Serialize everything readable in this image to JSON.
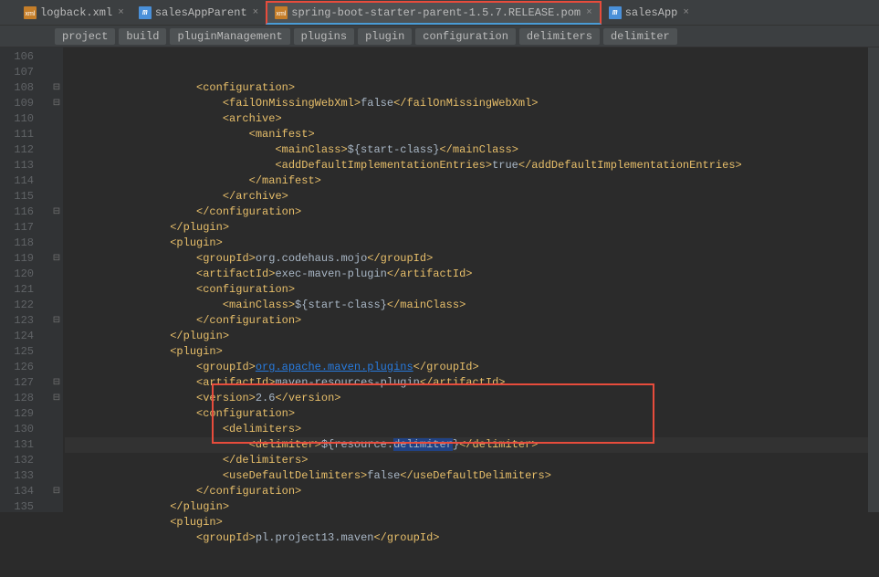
{
  "tabs": [
    {
      "icon": "xml",
      "label": "logback.xml"
    },
    {
      "icon": "m",
      "label": "salesAppParent"
    },
    {
      "icon": "xml",
      "label": "spring-boot-starter-parent-1.5.7.RELEASE.pom",
      "highlighted": true
    },
    {
      "icon": "m",
      "label": "salesApp"
    }
  ],
  "breadcrumbs": [
    "project",
    "build",
    "pluginManagement",
    "plugins",
    "plugin",
    "configuration",
    "delimiters",
    "delimiter"
  ],
  "lines": {
    "start": 106,
    "end": 135
  },
  "code": {
    "l106": {
      "indent": "                    ",
      "parts": [
        {
          "t": "tag",
          "v": "<configuration>"
        }
      ]
    },
    "l107": {
      "indent": "                        ",
      "parts": [
        {
          "t": "tag",
          "v": "<failOnMissingWebXml>"
        },
        {
          "t": "text",
          "v": "false"
        },
        {
          "t": "tag",
          "v": "</failOnMissingWebXml>"
        }
      ]
    },
    "l108": {
      "indent": "                        ",
      "parts": [
        {
          "t": "tag",
          "v": "<archive>"
        }
      ]
    },
    "l109": {
      "indent": "                            ",
      "parts": [
        {
          "t": "tag",
          "v": "<manifest>"
        }
      ]
    },
    "l110": {
      "indent": "                                ",
      "parts": [
        {
          "t": "tag",
          "v": "<mainClass>"
        },
        {
          "t": "text",
          "v": "${start-class}"
        },
        {
          "t": "tag",
          "v": "</mainClass>"
        }
      ]
    },
    "l111": {
      "indent": "                                ",
      "parts": [
        {
          "t": "tag",
          "v": "<addDefaultImplementationEntries>"
        },
        {
          "t": "text",
          "v": "true"
        },
        {
          "t": "tag",
          "v": "</addDefaultImplementationEntries>"
        }
      ]
    },
    "l112": {
      "indent": "                            ",
      "parts": [
        {
          "t": "tag",
          "v": "</manifest>"
        }
      ]
    },
    "l113": {
      "indent": "                        ",
      "parts": [
        {
          "t": "tag",
          "v": "</archive>"
        }
      ]
    },
    "l114": {
      "indent": "                    ",
      "parts": [
        {
          "t": "tag",
          "v": "</configuration>"
        }
      ]
    },
    "l115": {
      "indent": "                ",
      "parts": [
        {
          "t": "tag",
          "v": "</plugin>"
        }
      ]
    },
    "l116": {
      "indent": "                ",
      "parts": [
        {
          "t": "tag",
          "v": "<plugin>"
        }
      ]
    },
    "l117": {
      "indent": "                    ",
      "parts": [
        {
          "t": "tag",
          "v": "<groupId>"
        },
        {
          "t": "text",
          "v": "org.codehaus.mojo"
        },
        {
          "t": "tag",
          "v": "</groupId>"
        }
      ]
    },
    "l118": {
      "indent": "                    ",
      "parts": [
        {
          "t": "tag",
          "v": "<artifactId>"
        },
        {
          "t": "text",
          "v": "exec-maven-plugin"
        },
        {
          "t": "tag",
          "v": "</artifactId>"
        }
      ]
    },
    "l119": {
      "indent": "                    ",
      "parts": [
        {
          "t": "tag",
          "v": "<configuration>"
        }
      ]
    },
    "l120": {
      "indent": "                        ",
      "parts": [
        {
          "t": "tag",
          "v": "<mainClass>"
        },
        {
          "t": "text",
          "v": "${start-class}"
        },
        {
          "t": "tag",
          "v": "</mainClass>"
        }
      ]
    },
    "l121": {
      "indent": "                    ",
      "parts": [
        {
          "t": "tag",
          "v": "</configuration>"
        }
      ]
    },
    "l122": {
      "indent": "                ",
      "parts": [
        {
          "t": "tag",
          "v": "</plugin>"
        }
      ]
    },
    "l123": {
      "indent": "                ",
      "parts": [
        {
          "t": "tag",
          "v": "<plugin>"
        }
      ]
    },
    "l124": {
      "indent": "                    ",
      "parts": [
        {
          "t": "tag",
          "v": "<groupId>"
        },
        {
          "t": "link",
          "v": "org.apache.maven.plugins"
        },
        {
          "t": "tag",
          "v": "</groupId>"
        }
      ]
    },
    "l125": {
      "indent": "                    ",
      "parts": [
        {
          "t": "tag",
          "v": "<artifactId>"
        },
        {
          "t": "text",
          "v": "maven-resources-plugin"
        },
        {
          "t": "tag",
          "v": "</artifactId>"
        }
      ]
    },
    "l126": {
      "indent": "                    ",
      "parts": [
        {
          "t": "tag",
          "v": "<version>"
        },
        {
          "t": "text",
          "v": "2.6"
        },
        {
          "t": "tag",
          "v": "</version>"
        }
      ]
    },
    "l127": {
      "indent": "                    ",
      "parts": [
        {
          "t": "tag",
          "v": "<configuration>"
        }
      ]
    },
    "l128": {
      "indent": "                        ",
      "parts": [
        {
          "t": "tag",
          "v": "<delimiters>"
        }
      ]
    },
    "l129": {
      "indent": "                            ",
      "parts": [
        {
          "t": "tag",
          "v": "<delimiter>"
        },
        {
          "t": "text",
          "v": "${resource."
        },
        {
          "t": "selected",
          "v": "delimiter"
        },
        {
          "t": "text",
          "v": "}"
        },
        {
          "t": "tag",
          "v": "</delimiter>"
        }
      ]
    },
    "l130": {
      "indent": "                        ",
      "parts": [
        {
          "t": "tag",
          "v": "</delimiters>"
        }
      ]
    },
    "l131": {
      "indent": "                        ",
      "parts": [
        {
          "t": "tag",
          "v": "<useDefaultDelimiters>"
        },
        {
          "t": "text",
          "v": "false"
        },
        {
          "t": "tag",
          "v": "</useDefaultDelimiters>"
        }
      ]
    },
    "l132": {
      "indent": "                    ",
      "parts": [
        {
          "t": "tag",
          "v": "</configuration>"
        }
      ]
    },
    "l133": {
      "indent": "                ",
      "parts": [
        {
          "t": "tag",
          "v": "</plugin>"
        }
      ]
    },
    "l134": {
      "indent": "                ",
      "parts": [
        {
          "t": "tag",
          "v": "<plugin>"
        }
      ]
    },
    "l135": {
      "indent": "                    ",
      "parts": [
        {
          "t": "tag",
          "v": "<groupId>"
        },
        {
          "t": "text",
          "v": "pl.project13.maven"
        },
        {
          "t": "tag",
          "v": "</groupId>"
        }
      ]
    }
  },
  "fold_markers": [
    108,
    109,
    116,
    119,
    123,
    127,
    128,
    134
  ]
}
